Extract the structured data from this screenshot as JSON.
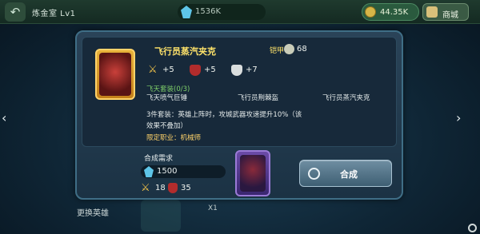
{
  "topbar": {
    "back_icon": "back-arrow-icon",
    "room_title": "炼金室 Lv1",
    "gem_amount": "1536K",
    "gold_amount": "44.35K",
    "shop_label": "商城"
  },
  "background": {
    "swap_hero_label": "更换英雄",
    "quantity_label": "X1"
  },
  "item": {
    "name": "飞行员蒸汽夹克",
    "type_label": "铠甲",
    "armor_value": "68",
    "stats": [
      {
        "icon": "sword-icon",
        "value": "+5"
      },
      {
        "icon": "red-shield-icon",
        "value": "+5"
      },
      {
        "icon": "white-shield-icon",
        "value": "+7"
      }
    ],
    "set_name": "飞天套装(0/3)",
    "set_items": [
      "飞天喷气巨锤",
      "飞行员荆棘盔",
      "飞行员蒸汽夹克"
    ],
    "set_bonus": "3件套装：英雄上阵时，攻城武器攻速提升10%（该效果不叠加）",
    "job_limit": "限定职业：机械师"
  },
  "craft": {
    "requirement_title": "合成需求",
    "gem_cost": "1500",
    "mat_sword": "18",
    "mat_shield": "35",
    "button_label": "合成"
  },
  "colors": {
    "gold_text": "#ffe36a",
    "set_green": "#7fd06a",
    "gem_blue": "#5ec5e8"
  }
}
